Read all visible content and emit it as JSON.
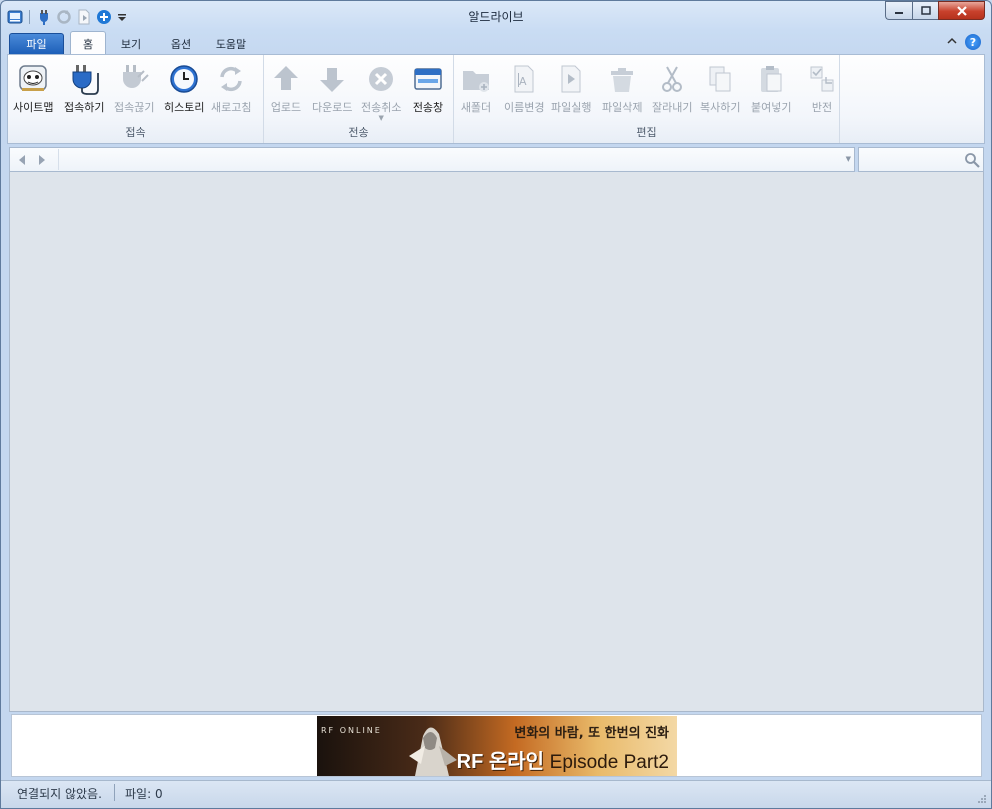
{
  "window": {
    "title": "알드라이브"
  },
  "quick_access": {
    "icons": [
      "app-icon",
      "connect-icon",
      "refresh-icon",
      "run-icon",
      "add-icon",
      "customize-dropdown-icon"
    ]
  },
  "tabs": [
    {
      "label": "파일",
      "type": "file"
    },
    {
      "label": "홈",
      "type": "active"
    },
    {
      "label": "보기",
      "type": "plain"
    },
    {
      "label": "옵션",
      "type": "plain"
    },
    {
      "label": "도움말",
      "type": "plain"
    }
  ],
  "ribbon": {
    "groups": {
      "connection": {
        "label": "접속",
        "buttons": [
          {
            "label": "사이트맵",
            "icon": "sitemap-icon",
            "enabled": true
          },
          {
            "label": "접속하기",
            "icon": "connect-plug-icon",
            "enabled": true
          },
          {
            "label": "접속끊기",
            "icon": "disconnect-plug-icon",
            "enabled": false
          },
          {
            "label": "히스토리",
            "icon": "history-clock-icon",
            "enabled": true
          },
          {
            "label": "새로고침",
            "icon": "refresh-icon",
            "enabled": false
          }
        ]
      },
      "transfer": {
        "label": "전송",
        "buttons": [
          {
            "label": "업로드",
            "icon": "upload-arrow-icon",
            "enabled": false
          },
          {
            "label": "다운로드",
            "icon": "download-arrow-icon",
            "enabled": false
          },
          {
            "label": "전송취소",
            "icon": "cancel-transfer-icon",
            "enabled": false
          },
          {
            "label": "전송창",
            "icon": "transfer-window-icon",
            "enabled": true
          }
        ]
      },
      "edit": {
        "label": "편집",
        "buttons": [
          {
            "label": "새폴더",
            "icon": "new-folder-icon",
            "enabled": false
          },
          {
            "label": "이름변경",
            "icon": "rename-icon",
            "enabled": false
          },
          {
            "label": "파일실행",
            "icon": "run-file-icon",
            "enabled": false
          },
          {
            "label": "파일삭제",
            "icon": "delete-file-icon",
            "enabled": false
          },
          {
            "label": "잘라내기",
            "icon": "cut-scissors-icon",
            "enabled": false
          },
          {
            "label": "복사하기",
            "icon": "copy-icon",
            "enabled": false
          },
          {
            "label": "붙여넣기",
            "icon": "paste-icon",
            "enabled": false
          },
          {
            "label": "반전",
            "icon": "invert-selection-icon",
            "enabled": false
          }
        ]
      }
    }
  },
  "address_bar": {
    "value": "",
    "placeholder": ""
  },
  "search": {
    "value": "",
    "placeholder": ""
  },
  "ad": {
    "brand": "RF ONLINE",
    "tagline": "변화의 바람, 또 한번의 진화",
    "title_main": "RF 온라인",
    "title_episode": "Episode Part2"
  },
  "status": {
    "connection": "연결되지 않았음.",
    "files": "파일: 0"
  }
}
